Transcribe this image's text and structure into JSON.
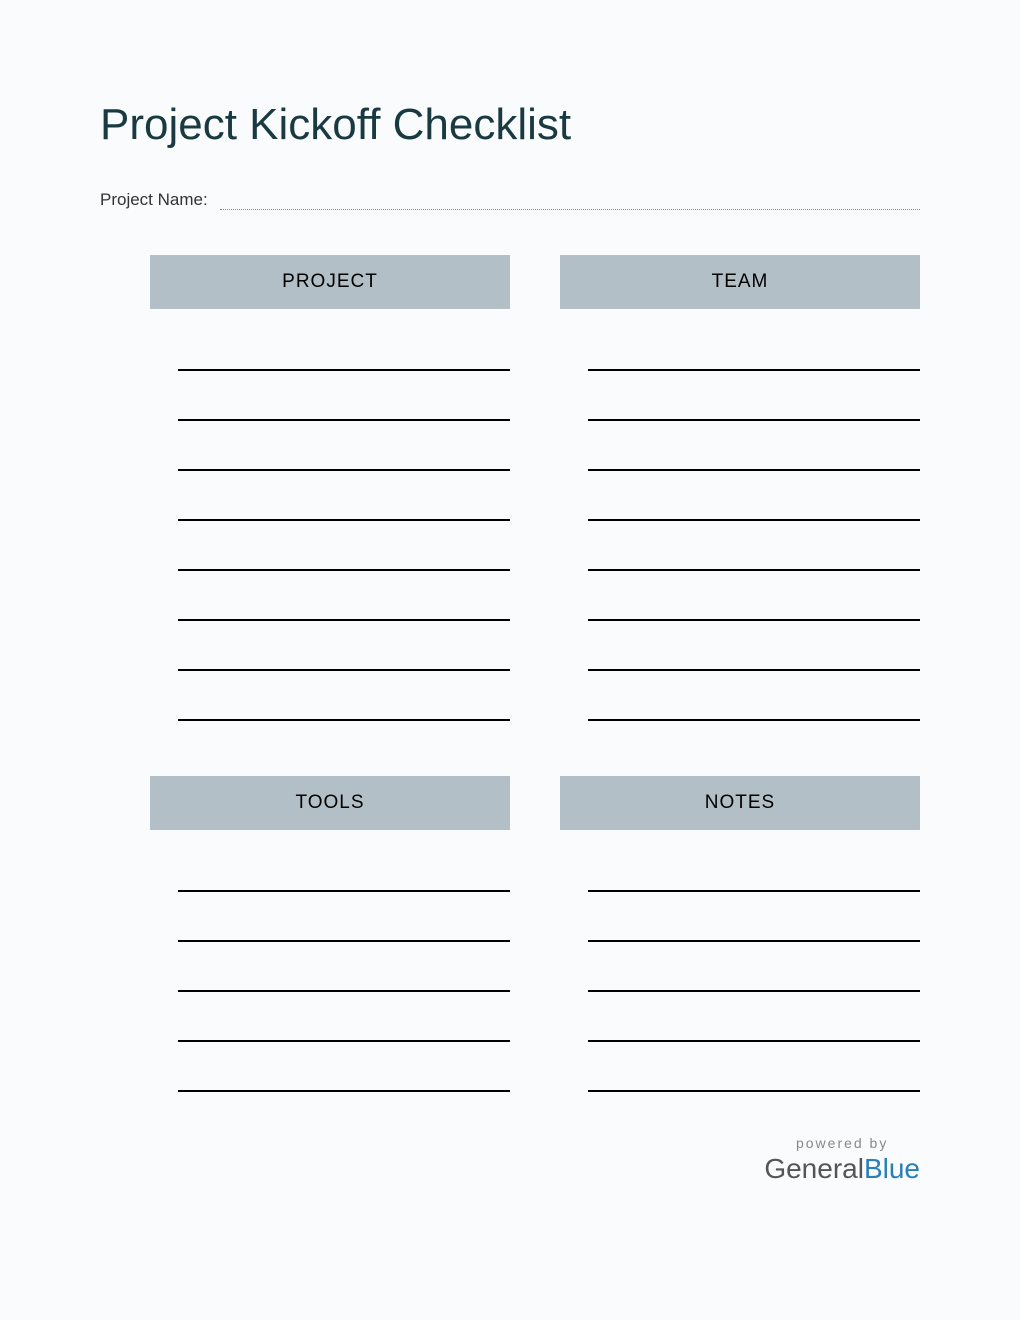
{
  "title": "Project Kickoff Checklist",
  "project_name_label": "Project Name:",
  "sections": {
    "project": {
      "header": "PROJECT",
      "line_count": 8
    },
    "team": {
      "header": "TEAM",
      "line_count": 8
    },
    "tools": {
      "header": "TOOLS",
      "line_count": 5
    },
    "notes": {
      "header": "NOTES",
      "line_count": 5
    }
  },
  "footer": {
    "powered_by": "powered by",
    "brand_part1": "General",
    "brand_part2": "Blue"
  }
}
